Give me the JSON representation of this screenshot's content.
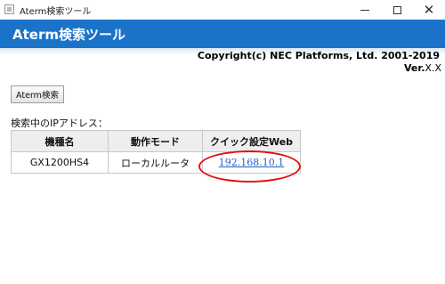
{
  "window": {
    "title": "Aterm検索ツール",
    "icon": "app-window-icon",
    "minimize_icon": "minimize-icon",
    "maximize_icon": "maximize-icon",
    "close_icon": "close-icon",
    "close_glyph": "✕"
  },
  "header": {
    "title": "Aterm検索ツール",
    "background_color": "#1a73c9"
  },
  "copyright": "Copyright(c) NEC Platforms, Ltd. 2001-2019",
  "version": {
    "label": "Ver.",
    "value": "X.X"
  },
  "search_button": {
    "label": "Aterm検索"
  },
  "searching_label": "検索中のIPアドレス：",
  "table": {
    "headers": [
      "機種名",
      "動作モード",
      "クイック設定Web"
    ],
    "rows": [
      {
        "model": "GX1200HS4",
        "mode": "ローカルルータ",
        "quick_setup_web": "192.168.10.1"
      }
    ]
  },
  "highlight_color": "#e01010",
  "link_color": "#1a5fd0"
}
